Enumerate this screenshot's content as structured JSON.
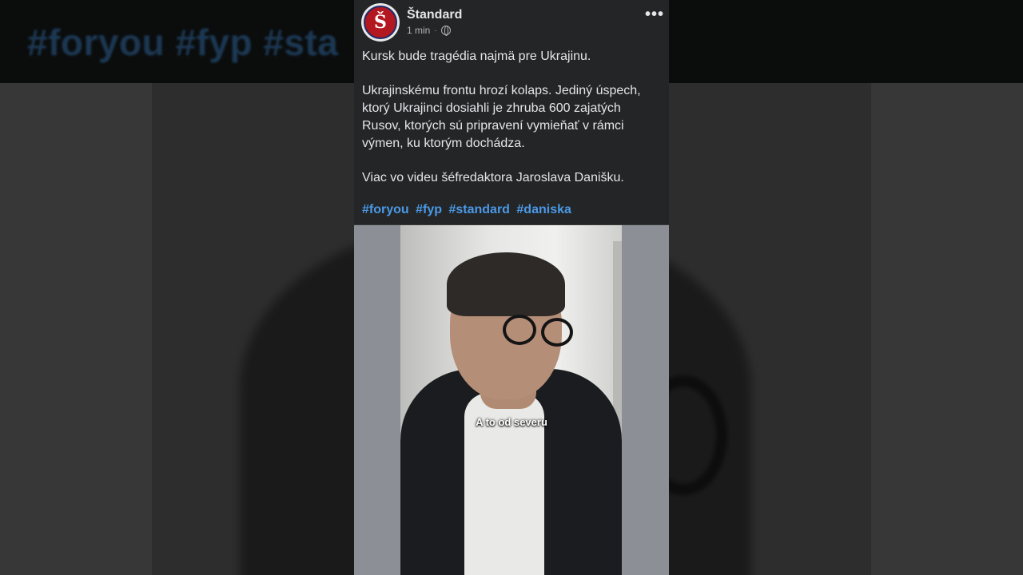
{
  "background": {
    "hashtags_text": "#foryou #fyp #sta"
  },
  "post": {
    "page_name": "Štandard",
    "avatar_letter": "Š",
    "timestamp": "1 min",
    "meta_separator": "·",
    "privacy_icon": "globe-icon",
    "more_icon": "•••",
    "paragraphs": [
      "Kursk bude tragédia najmä pre Ukrajinu.",
      "Ukrajinskému frontu hrozí kolaps. Jediný úspech, ktorý Ukrajinci dosiahli je zhruba 600 zajatých Rusov, ktorých sú pripravení vymieňať v rámci výmen, ku ktorým dochádza.",
      "Viac vo videu šéfredaktora Jaroslava Danišku."
    ],
    "hashtags": [
      "#foryou",
      "#fyp",
      "#standard",
      "#daniska"
    ],
    "video_subtitle": "A to od severu"
  },
  "colors": {
    "card_bg": "#242526",
    "text": "#e4e6eb",
    "hashtag": "#4a9ae8",
    "avatar_red": "#b3171f"
  }
}
